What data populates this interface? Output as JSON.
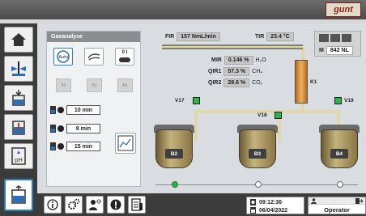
{
  "logo": {
    "text": "gunt"
  },
  "panel": {
    "title": "Gasanalyse",
    "auto_label": "Auto",
    "toggle_label": "0 I",
    "vessels": [
      "B2",
      "B3",
      "B4"
    ],
    "timers": [
      {
        "value": "10 min"
      },
      {
        "value": "8 min"
      },
      {
        "value": "15 min"
      }
    ]
  },
  "process": {
    "fir": {
      "label": "FIR",
      "value": "157 NmL/min"
    },
    "tir": {
      "label": "TIR",
      "value": "23.4 °C"
    },
    "mir": {
      "label": "MIR",
      "value": "0.146 %",
      "unit": "H₂O"
    },
    "qir1": {
      "label": "QIR1",
      "value": "57.3 %",
      "unit": "CH₄"
    },
    "qir2": {
      "label": "QIR2",
      "value": "28.6 %",
      "unit": "CO₂"
    },
    "column": {
      "label": "K1"
    },
    "valves": {
      "v17": "V17",
      "v18": "V18",
      "v19": "V19"
    },
    "tanks": [
      "B2",
      "B3",
      "B4"
    ],
    "m_box": {
      "label": "M",
      "value": "842 NL"
    }
  },
  "footer": {
    "time": "09:12:36",
    "date": "06/04/2022",
    "user": "Operator"
  }
}
